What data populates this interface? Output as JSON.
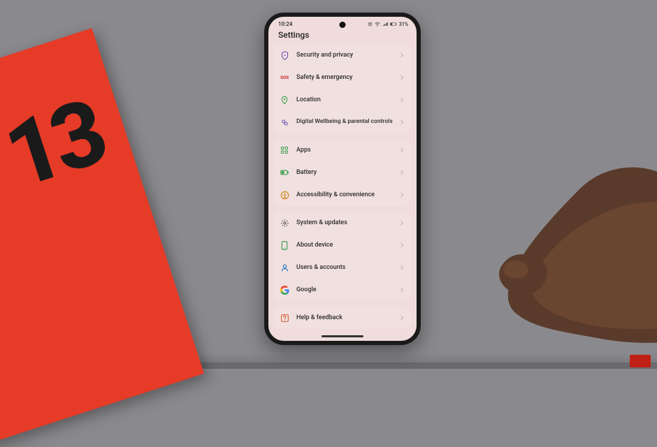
{
  "status": {
    "time": "10:24",
    "battery_text": "31%"
  },
  "header": {
    "title": "Settings"
  },
  "groups": [
    {
      "cut_top": true,
      "rows": [
        {
          "icon": "shield-lock-icon",
          "color": "#6a4fb5",
          "label": "Security and privacy"
        },
        {
          "icon": "sos-icon",
          "color": "#c83a3a",
          "label": "Safety & emergency",
          "sos": true
        },
        {
          "icon": "location-pin-icon",
          "color": "#2a9b42",
          "label": "Location"
        },
        {
          "icon": "wellbeing-icon",
          "color": "#6a4fb5",
          "label": "Digital Wellbeing & parental controls",
          "twoline": true
        }
      ]
    },
    {
      "rows": [
        {
          "icon": "apps-grid-icon",
          "color": "#2a9b42",
          "label": "Apps"
        },
        {
          "icon": "battery-icon",
          "color": "#2a9b42",
          "label": "Battery"
        },
        {
          "icon": "accessibility-icon",
          "color": "#d08414",
          "label": "Accessibility & convenience"
        }
      ]
    },
    {
      "rows": [
        {
          "icon": "gear-icon",
          "color": "#444",
          "label": "System & updates"
        },
        {
          "icon": "phone-device-icon",
          "color": "#2a9b42",
          "label": "About device"
        },
        {
          "icon": "user-icon",
          "color": "#1a6fc2",
          "label": "Users & accounts"
        },
        {
          "icon": "google-icon",
          "color": "multi",
          "label": "Google"
        }
      ]
    },
    {
      "rows": [
        {
          "icon": "help-icon",
          "color": "#d35a2c",
          "label": "Help & feedback"
        }
      ]
    }
  ],
  "box_text": "13"
}
